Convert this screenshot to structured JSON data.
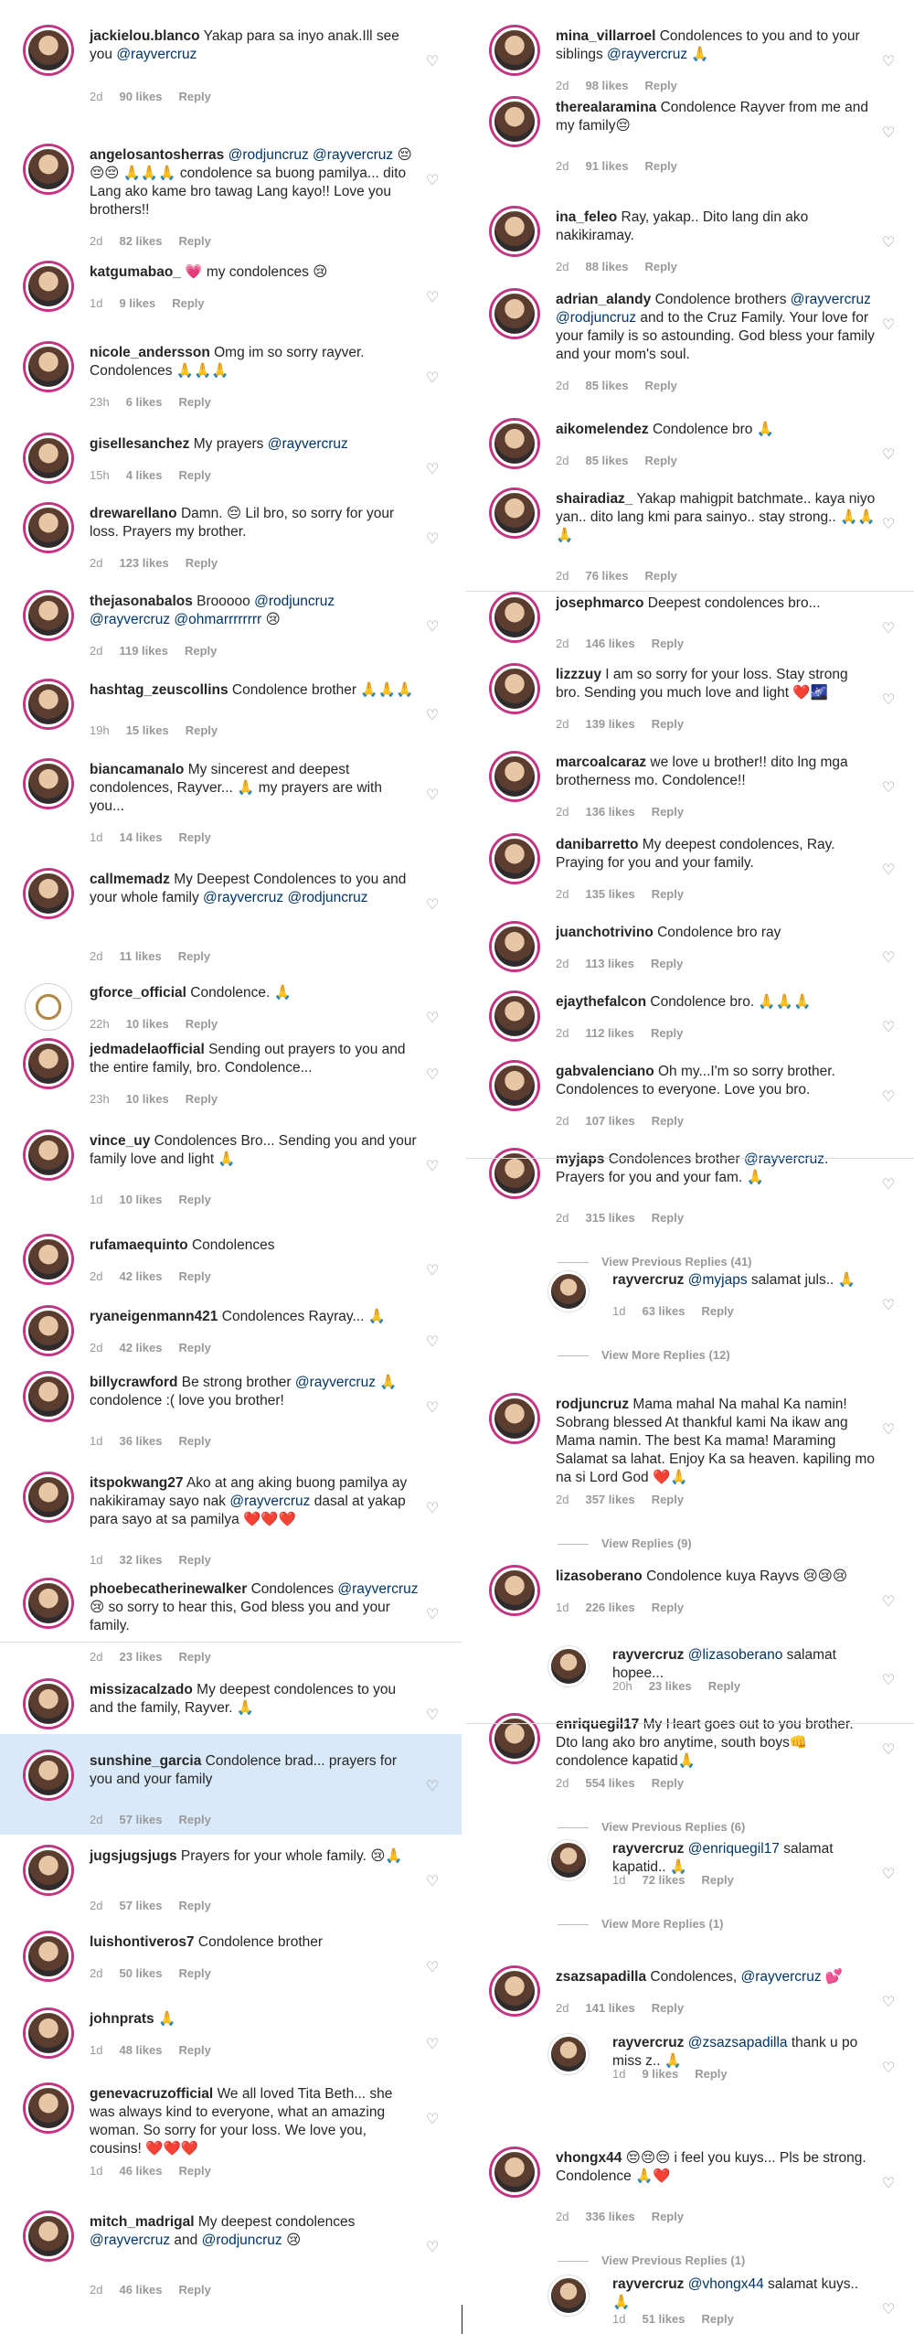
{
  "left_comments": [
    {
      "user": "jackielou.blanco",
      "text": "Yakap para sa inyo anak.Ill see you @rayvercruz",
      "time": "2d",
      "likes": "90 likes",
      "reply": "Reply"
    },
    {
      "user": "angelosantosherras",
      "text": "@rodjuncruz @rayvercruz 😔😔😔 🙏🙏🙏 condolence sa buong pamilya... dito Lang ako kame bro tawag Lang kayo!! Love you brothers!!",
      "time": "2d",
      "likes": "82 likes",
      "reply": "Reply"
    },
    {
      "user": "katgumabao_",
      "text": "💗 my condolences 😢",
      "time": "1d",
      "likes": "9 likes",
      "reply": "Reply"
    },
    {
      "user": "nicole_andersson",
      "text": "Omg im so sorry rayver. Condolences 🙏🙏🙏",
      "time": "23h",
      "likes": "6 likes",
      "reply": "Reply"
    },
    {
      "user": "gisellesanchez",
      "text": "My prayers @rayvercruz",
      "time": "15h",
      "likes": "4 likes",
      "reply": "Reply"
    },
    {
      "user": "drewarellano",
      "text": "Damn. 😔 Lil bro, so sorry for your loss. Prayers my brother.",
      "time": "2d",
      "likes": "123 likes",
      "reply": "Reply"
    },
    {
      "user": "thejasonabalos",
      "text": "Brooooo @rodjuncruz @rayvercruz @ohmarrrrrrrr 😢",
      "time": "2d",
      "likes": "119 likes",
      "reply": "Reply"
    },
    {
      "user": "hashtag_zeuscollins",
      "text": "Condolence brother 🙏🙏🙏",
      "time": "19h",
      "likes": "15 likes",
      "reply": "Reply"
    },
    {
      "user": "biancamanalo",
      "text": "My sincerest and deepest condolences, Rayver... 🙏 my prayers are with you...",
      "time": "1d",
      "likes": "14 likes",
      "reply": "Reply"
    },
    {
      "user": "callmemadz",
      "text": "My Deepest Condolences to you and your whole family @rayvercruz @rodjuncruz",
      "time": "2d",
      "likes": "11 likes",
      "reply": "Reply"
    },
    {
      "user": "gforce_official",
      "text": "Condolence. 🙏",
      "time": "22h",
      "likes": "10 likes",
      "reply": "Reply"
    },
    {
      "user": "jedmadelaofficial",
      "text": "Sending out prayers to you and the entire family, bro. Condolence...",
      "time": "23h",
      "likes": "10 likes",
      "reply": "Reply"
    },
    {
      "user": "vince_uy",
      "text": "Condolences Bro... Sending you and your family love and light 🙏",
      "time": "1d",
      "likes": "10 likes",
      "reply": "Reply"
    },
    {
      "user": "rufamaequinto",
      "text": "Condolences",
      "time": "2d",
      "likes": "42 likes",
      "reply": "Reply"
    },
    {
      "user": "ryaneigenmann421",
      "text": "Condolences Rayray... 🙏",
      "time": "2d",
      "likes": "42 likes",
      "reply": "Reply"
    },
    {
      "user": "billycrawford",
      "text": "Be strong brother @rayvercruz 🙏 condolence :( love you brother!",
      "time": "1d",
      "likes": "36 likes",
      "reply": "Reply"
    },
    {
      "user": "itspokwang27",
      "text": "Ako at ang aking buong pamilya ay nakikiramay sayo nak @rayvercruz dasal at yakap para sayo at sa pamilya ❤️❤️❤️",
      "time": "1d",
      "likes": "32 likes",
      "reply": "Reply"
    },
    {
      "user": "phoebecatherinewalker",
      "text": "Condolences @rayvercruz 😢 so sorry to hear this, God bless you and your family.",
      "time": "2d",
      "likes": "23 likes",
      "reply": "Reply"
    },
    {
      "user": "missizacalzado",
      "text": "My deepest condolences to you and the family, Rayver. 🙏",
      "time": "1d",
      "likes": "57 likes",
      "reply": "Reply"
    },
    {
      "user": "sunshine_garcia",
      "text": "Condolence brad... prayers for you and your family",
      "time": "2d",
      "likes": "57 likes",
      "reply": "Reply"
    },
    {
      "user": "jugsjugsjugs",
      "text": "Prayers for your whole family. 😢🙏",
      "time": "2d",
      "likes": "57 likes",
      "reply": "Reply"
    },
    {
      "user": "luishontiveros7",
      "text": "Condolence brother",
      "time": "2d",
      "likes": "50 likes",
      "reply": "Reply"
    },
    {
      "user": "johnprats",
      "text": "🙏",
      "time": "1d",
      "likes": "48 likes",
      "reply": "Reply"
    },
    {
      "user": "genevacruzofficial",
      "text": "We all loved Tita Beth... she was always kind to everyone, what an amazing woman. So sorry for your loss. We love you, cousins! ❤️❤️❤️",
      "time": "1d",
      "likes": "46 likes",
      "reply": "Reply"
    },
    {
      "user": "mitch_madrigal",
      "text": "My deepest condolences @rayvercruz and @rodjuncruz 😢",
      "time": "2d",
      "likes": "46 likes",
      "reply": "Reply"
    }
  ],
  "right_comments": [
    {
      "user": "mina_villarroel",
      "text": "Condolences to you and to your siblings @rayvercruz 🙏",
      "time": "2d",
      "likes": "98 likes",
      "reply": "Reply"
    },
    {
      "user": "therealaramina",
      "text": "Condolence Rayver from me and my family😔",
      "time": "2d",
      "likes": "91 likes",
      "reply": "Reply"
    },
    {
      "user": "ina_feleo",
      "text": "Ray, yakap.. Dito lang din ako nakikiramay.",
      "time": "2d",
      "likes": "88 likes",
      "reply": "Reply"
    },
    {
      "user": "adrian_alandy",
      "text": "Condolence brothers @rayvercruz @rodjuncruz and to the Cruz Family. Your love for your family is so astounding. God bless your family and your mom's soul.",
      "time": "2d",
      "likes": "85 likes",
      "reply": "Reply"
    },
    {
      "user": "aikomelendez",
      "text": "Condolence bro 🙏",
      "time": "2d",
      "likes": "85 likes",
      "reply": "Reply"
    },
    {
      "user": "shairadiaz_",
      "text": "Yakap mahigpit batchmate.. kaya niyo yan.. dito lang kmi para sainyo.. stay strong.. 🙏🙏🙏",
      "time": "2d",
      "likes": "76 likes",
      "reply": "Reply"
    },
    {
      "user": "josephmarco",
      "text": "Deepest condolences bro...",
      "time": "2d",
      "likes": "146 likes",
      "reply": "Reply"
    },
    {
      "user": "lizzzuy",
      "text": "I am so sorry for your loss. Stay strong bro. Sending you much love and light ❤️🌌",
      "time": "2d",
      "likes": "139 likes",
      "reply": "Reply"
    },
    {
      "user": "marcoalcaraz",
      "text": "we love u brother!! dito lng mga brotherness mo. Condolence!!",
      "time": "2d",
      "likes": "136 likes",
      "reply": "Reply"
    },
    {
      "user": "danibarretto",
      "text": "My deepest condolences, Ray. Praying for you and your family.",
      "time": "2d",
      "likes": "135 likes",
      "reply": "Reply"
    },
    {
      "user": "juanchotrivino",
      "text": "Condolence bro ray",
      "time": "2d",
      "likes": "113 likes",
      "reply": "Reply"
    },
    {
      "user": "ejaythefalcon",
      "text": "Condolence bro. 🙏🙏🙏",
      "time": "2d",
      "likes": "112 likes",
      "reply": "Reply"
    },
    {
      "user": "gabvalenciano",
      "text": "Oh my...I'm so sorry brother. Condolences to everyone. Love you bro.",
      "time": "2d",
      "likes": "107 likes",
      "reply": "Reply"
    },
    {
      "user": "myjaps",
      "text": "Condolences brother @rayvercruz. Prayers for you and your fam. 🙏",
      "time": "2d",
      "likes": "315 likes",
      "reply": "Reply",
      "view_replies": "View Previous Replies (41)"
    },
    {
      "user": "rayvercruz",
      "text": "@myjaps salamat juls.. 🙏",
      "time": "1d",
      "likes": "63 likes",
      "reply": "Reply",
      "view_replies": "View More Replies (12)"
    },
    {
      "user": "rodjuncruz",
      "text": "Mama mahal Na mahal Ka namin! Sobrang blessed At thankful kami Na ikaw ang Mama namin. The best Ka mama! Maraming Salamat sa lahat. Enjoy Ka sa heaven. kapiling mo na si Lord God ❤️🙏",
      "time": "2d",
      "likes": "357 likes",
      "reply": "Reply",
      "view_replies": "View Replies (9)"
    },
    {
      "user": "lizasoberano",
      "text": "Condolence kuya Rayvs 😢😢😢",
      "time": "1d",
      "likes": "226 likes",
      "reply": "Reply"
    },
    {
      "user": "rayvercruz",
      "text": "@lizasoberano salamat hopee...",
      "time": "20h",
      "likes": "23 likes",
      "reply": "Reply"
    },
    {
      "user": "enriquegil17",
      "text": "My Heart goes out to you brother. Dto lang ako bro anytime, south boys👊 condolence kapatid🙏",
      "time": "2d",
      "likes": "554 likes",
      "reply": "Reply",
      "view_replies": "View Previous Replies (6)"
    },
    {
      "user": "rayvercruz",
      "text": "@enriquegil17 salamat kapatid.. 🙏",
      "time": "1d",
      "likes": "72 likes",
      "reply": "Reply",
      "view_replies": "View More Replies (1)"
    },
    {
      "user": "zsazsapadilla",
      "text": "Condolences, @rayvercruz 💕",
      "time": "2d",
      "likes": "141 likes",
      "reply": "Reply"
    },
    {
      "user": "rayvercruz",
      "text": "@zsazsapadilla thank u po miss z.. 🙏",
      "time": "1d",
      "likes": "9 likes",
      "reply": "Reply"
    },
    {
      "user": "vhongx44",
      "text": "😔😔😔 i feel you kuys... Pls be strong. Condolence 🙏❤️",
      "time": "2d",
      "likes": "336 likes",
      "reply": "Reply",
      "view_replies": "View Previous Replies (1)"
    },
    {
      "user": "rayvercruz",
      "text": "@vhongx44 salamat kuys.. 🙏",
      "time": "1d",
      "likes": "51 likes",
      "reply": "Reply"
    }
  ],
  "colors": {
    "mention": "#003569",
    "meta": "#999999",
    "story_ring": "#c13584",
    "highlight": "#d9e9f9"
  },
  "icons": {
    "like": "heart-outline-icon"
  }
}
